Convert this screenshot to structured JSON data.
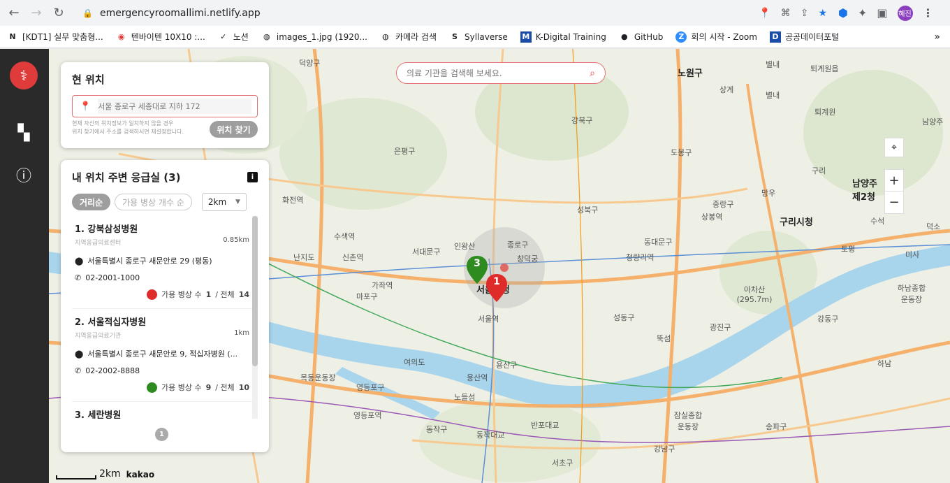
{
  "browser": {
    "url": "emergencyroomallimi.netlify.app",
    "profile_label": "혜진",
    "bookmarks": [
      {
        "label": "[KDT1] 실무 맞춤형...",
        "icon": "notion-icon"
      },
      {
        "label": "텐바이텐 10X10 :...",
        "icon": "tenbyten-icon"
      },
      {
        "label": "노션",
        "icon": "check-icon"
      },
      {
        "label": "images_1.jpg (1920...",
        "icon": "globe-icon"
      },
      {
        "label": "카메라 검색",
        "icon": "globe-icon"
      },
      {
        "label": "Syllaverse",
        "icon": "syllaverse-icon"
      },
      {
        "label": "K-Digital Training",
        "icon": "kdt-icon"
      },
      {
        "label": "GitHub",
        "icon": "github-icon"
      },
      {
        "label": "회의 시작 - Zoom",
        "icon": "zoom-icon"
      },
      {
        "label": "공공데이터포털",
        "icon": "data-portal-icon"
      }
    ]
  },
  "search": {
    "placeholder": "의료 기관을 검색해 보세요."
  },
  "location_panel": {
    "title": "현 위치",
    "address_placeholder": "서울 종로구 세종대로 지하 172",
    "hint_line1": "현재 자신의 위치정보가 일치하지 않을 경우",
    "hint_line2": "위치 찾기에서 주소를 검색하시면 재설정합니다.",
    "find_button": "위치 찾기"
  },
  "er_panel": {
    "title": "내 위치 주변 응급실 (3)",
    "info_label": "i",
    "sort_by_distance": "거리순",
    "sort_by_beds": "가용 병상 개수 순",
    "distance_select": "2km",
    "page_number": "1",
    "items": [
      {
        "name": "1. 강북삼성병원",
        "type": "지역응급의료센터",
        "distance": "0.85km",
        "address": "서울특별시 종로구 새문안로 29 (평동)",
        "phone": "02-2001-1000",
        "beds_label": "가용 병상 수",
        "available": "1",
        "total_label": "/ 전체",
        "total": "14",
        "status_color": "#e02b2b"
      },
      {
        "name": "2. 서울적십자병원",
        "type": "지역응급의료기관",
        "distance": "1km",
        "address": "서울특별시 종로구 새문안로 9, 적십자병원 (...",
        "phone": "02-2002-8888",
        "beds_label": "가용 병상 수",
        "available": "9",
        "total_label": "/ 전체",
        "total": "10",
        "status_color": "#2e8b1f"
      },
      {
        "name": "3. 세란병원",
        "type": "",
        "distance": "",
        "address": "",
        "phone": "",
        "beds_label": "",
        "available": "",
        "total_label": "",
        "total": "",
        "status_color": "#e02b2b"
      }
    ]
  },
  "map": {
    "scale_label": "2km",
    "provider": "kakao",
    "markers": [
      {
        "label": "1",
        "color": "#e02b2b"
      },
      {
        "label": "3",
        "color": "#2e8b1f"
      }
    ],
    "labels": [
      "덕양구",
      "노원구",
      "퇴계원읍",
      "별내",
      "남양주",
      "은평구",
      "강북구",
      "도봉구",
      "구리",
      "마포구",
      "서대문구",
      "종로구",
      "성북구",
      "동대문구",
      "중랑구",
      "구리시청",
      "남양주 제2청",
      "서울시청",
      "서울역",
      "용산구",
      "성동구",
      "광진구",
      "영등포구",
      "동작구",
      "강남구",
      "서초구",
      "송파구",
      "강동구",
      "하남",
      "인왕산",
      "창덕궁",
      "청량리역",
      "아차산 (295.7m)",
      "용산역",
      "신촌역",
      "가좌역",
      "화전역",
      "수색역",
      "난지도",
      "노들섬",
      "여의도",
      "반포대교",
      "동작대교",
      "잠실종합운동장",
      "하남종합운동장",
      "뚝섬",
      "상봉역",
      "토평",
      "미사",
      "덕소",
      "수석",
      "망우",
      "상계",
      "퇴계원",
      "별내",
      "영등포역",
      "목동운동장"
    ]
  }
}
